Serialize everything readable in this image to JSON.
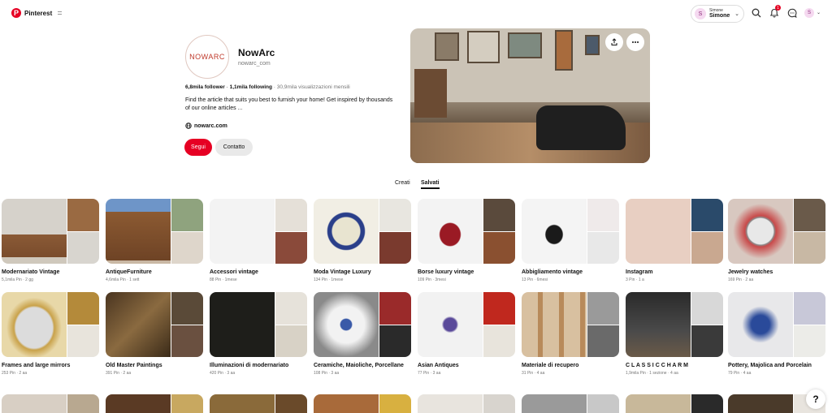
{
  "header": {
    "brand": "Pinterest",
    "user_small": "Simone",
    "user_name": "Simone",
    "avatar_letter": "S",
    "notification_count": "1"
  },
  "profile": {
    "logo_text": "NOWARC",
    "name": "NowArc",
    "handle": "nowarc_com",
    "followers": "6,8mila follower",
    "following": "1,1mila following",
    "views": "30,9mila visualizzazioni mensili",
    "bio": "Find the article that suits you best to furnish your home! Get inspired by thousands of our online articles ...",
    "website": "nowarc.com",
    "follow_label": "Segui",
    "contact_label": "Contatto"
  },
  "tabs": [
    {
      "label": "Creati"
    },
    {
      "label": "Salvati"
    }
  ],
  "boards": [
    {
      "title": "Modernariato Vintage",
      "meta": "5,1mila Pin · 2 gg"
    },
    {
      "title": "AntiqueFurniture",
      "meta": "4,6mila Pin · 1 sett"
    },
    {
      "title": "Accessori vintage",
      "meta": "88 Pin · 1mese"
    },
    {
      "title": "Moda Vintage Luxury",
      "meta": "134 Pin · 1mese"
    },
    {
      "title": "Borse luxury vintage",
      "meta": "109 Pin · 3mesi"
    },
    {
      "title": "Abbigliamento vintage",
      "meta": "13 Pin · 6mesi"
    },
    {
      "title": "Instagram",
      "meta": "3 Pin · 1 a"
    },
    {
      "title": "Jewelry watches",
      "meta": "169 Pin · 2 aa"
    },
    {
      "title": "Frames and large mirrors",
      "meta": "253 Pin · 2 aa"
    },
    {
      "title": "Old Master Paintings",
      "meta": "391 Pin · 2 aa"
    },
    {
      "title": "Illuminazioni di modernariato",
      "meta": "420 Pin · 3 aa"
    },
    {
      "title": "Ceramiche, Maioliche, Porcellane",
      "meta": "108 Pin · 3 aa"
    },
    {
      "title": "Asian Antiques",
      "meta": "77 Pin · 3 aa"
    },
    {
      "title": "Materiale di recupero",
      "meta": "31 Pin · 4 aa"
    },
    {
      "title": "C L A S S I C C H A R M",
      "meta": "1,9mila Pin · 1 sezione · 4 aa"
    },
    {
      "title": "Pottery, Majolica and Porcelain",
      "meta": "79 Pin · 4 aa"
    }
  ],
  "colors": {
    "brand_red": "#e60023",
    "muted_text": "#767676"
  }
}
